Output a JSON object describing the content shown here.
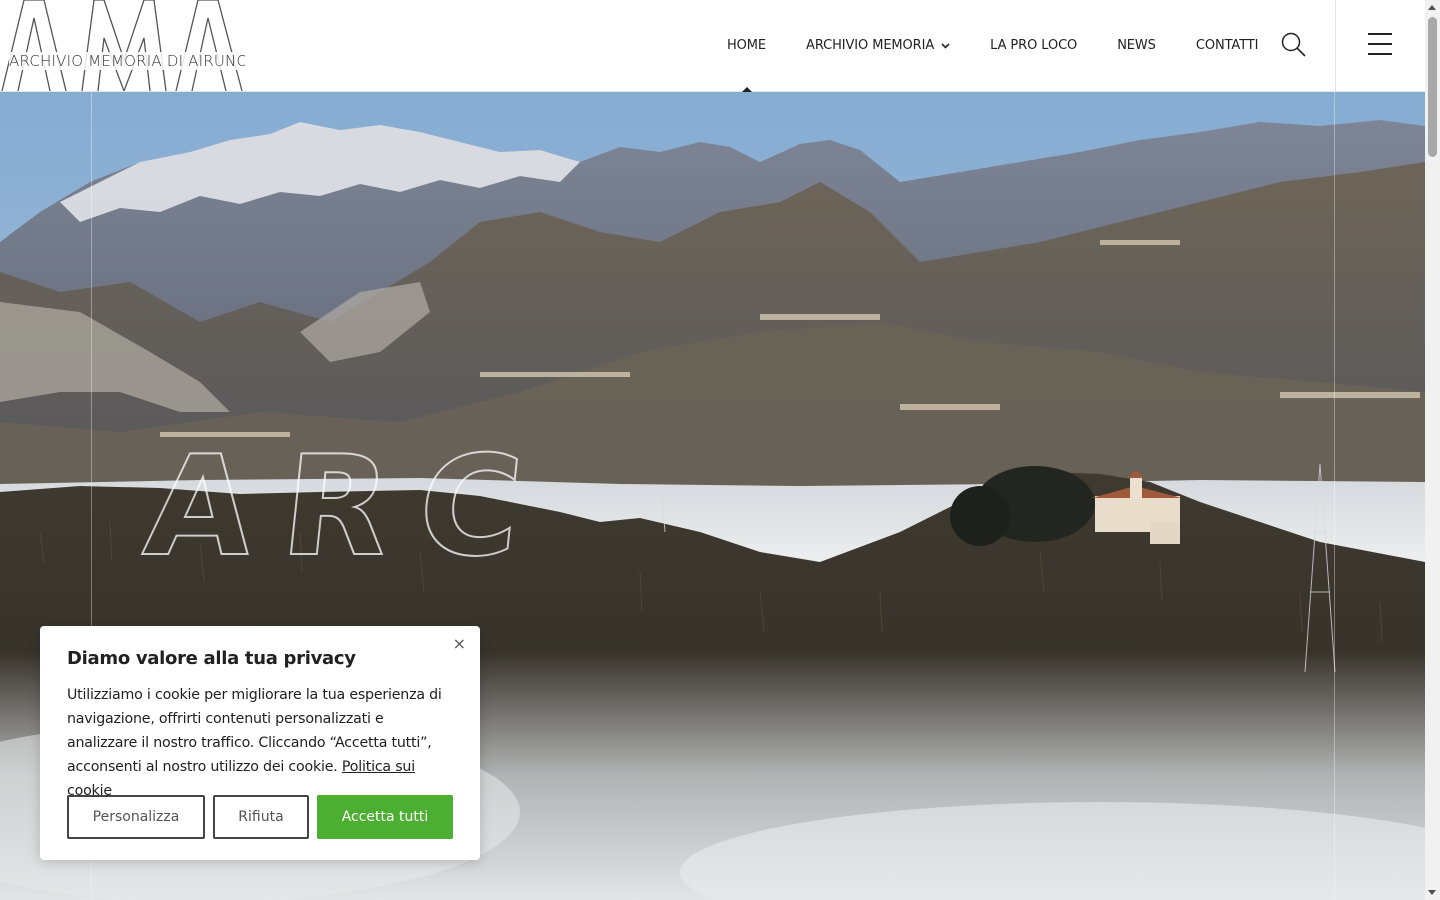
{
  "logo": {
    "letters": "AMA",
    "subtitle": "ARCHIVIO MEMORIA DI AIRUNO"
  },
  "nav": {
    "items": [
      {
        "label": "HOME",
        "active": true
      },
      {
        "label": "ARCHIVIO MEMORIA",
        "has_dropdown": true,
        "caret": "⌄"
      },
      {
        "label": "LA PRO LOCO"
      },
      {
        "label": "NEWS"
      },
      {
        "label": "CONTATTI"
      }
    ],
    "search_icon": "search-icon",
    "menu_icon": "hamburger-menu-icon"
  },
  "hero": {
    "watermark_text": "ARC",
    "image_description_icon": "mountain-landscape-photo"
  },
  "cookie_banner": {
    "close_label": "×",
    "title": "Diamo valore alla tua privacy",
    "body": "Utilizziamo i cookie per migliorare la tua esperienza di navigazione, offrirti contenuti personalizzati e analizzare il nostro traffico. Cliccando “Accetta tutti”, acconsenti al nostro utilizzo dei cookie.",
    "policy_link": "Politica sui cookie",
    "buttons": {
      "customize": "Personalizza",
      "reject": "Rifiuta",
      "accept": "Accetta tutti"
    },
    "accept_color": "#4caf31"
  }
}
